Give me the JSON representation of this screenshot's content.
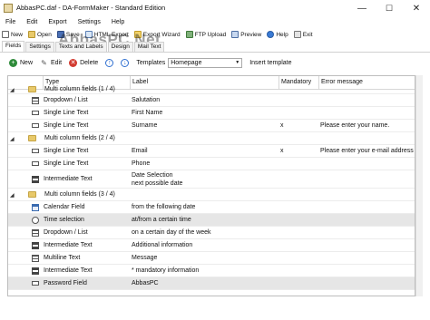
{
  "window": {
    "title": "AbbasPC.daf - DA-FormMaker - Standard Edition",
    "minimize": "—",
    "maximize": "☐",
    "close": "✕"
  },
  "menu": [
    "File",
    "Edit",
    "Export",
    "Settings",
    "Help"
  ],
  "toolbar": {
    "new": "New",
    "open": "Open",
    "save": "Save",
    "html_export": "HTML Export",
    "export_wizard": "Export Wizard",
    "ftp_upload": "FTP Upload",
    "preview": "Preview",
    "help": "Help",
    "exit": "Exit"
  },
  "watermark": "AbbasPC.Net",
  "tabs": [
    "Fields",
    "Settings",
    "Texts and Labels",
    "Design",
    "Mail Text"
  ],
  "actions": {
    "new": "New",
    "edit": "Edit",
    "delete": "Delete",
    "templates_label": "Templates",
    "templates_value": "Homepage",
    "insert_template": "Insert template"
  },
  "columns": {
    "type": "Type",
    "label": "Label",
    "mandatory": "Mandatory",
    "error": "Error message"
  },
  "rows": [
    {
      "kind": "group",
      "type": "Multi column fields (1 / 4)",
      "label": "",
      "mandatory": "",
      "error": ""
    },
    {
      "kind": "field",
      "icon": "dropdown-list",
      "type": "Dropdown / List",
      "label": "Salutation",
      "mandatory": "",
      "error": ""
    },
    {
      "kind": "field",
      "icon": "single-line",
      "type": "Single Line Text",
      "label": "First Name",
      "mandatory": "",
      "error": ""
    },
    {
      "kind": "field",
      "icon": "single-line",
      "type": "Single Line Text",
      "label": "Surname",
      "mandatory": "x",
      "error": "Please enter your name."
    },
    {
      "kind": "group",
      "type": "Multi column fields (2 / 4)",
      "label": "",
      "mandatory": "",
      "error": ""
    },
    {
      "kind": "field",
      "icon": "single-line",
      "type": "Single Line Text",
      "label": "Email",
      "mandatory": "x",
      "error": "Please enter your e-mail address sc"
    },
    {
      "kind": "field",
      "icon": "single-line",
      "type": "Single Line Text",
      "label": "Phone",
      "mandatory": "",
      "error": ""
    },
    {
      "kind": "field",
      "icon": "intermediate-text",
      "type": "Intermediate Text",
      "label": "Date Selection",
      "label2": "next possible date",
      "mandatory": "",
      "error": ""
    },
    {
      "kind": "group",
      "type": "Multi column fields (3 / 4)",
      "label": "",
      "mandatory": "",
      "error": ""
    },
    {
      "kind": "field",
      "icon": "calendar",
      "type": "Calendar Field",
      "label": "from the following date",
      "mandatory": "",
      "error": ""
    },
    {
      "kind": "field",
      "icon": "time",
      "type": "Time selection",
      "label": "at/from a certain time",
      "mandatory": "",
      "error": "",
      "selected": true
    },
    {
      "kind": "field",
      "icon": "dropdown-list",
      "type": "Dropdown / List",
      "label": "on a certain day of the week",
      "mandatory": "",
      "error": ""
    },
    {
      "kind": "field",
      "icon": "intermediate-text",
      "type": "Intermediate Text",
      "label": "Additional information",
      "mandatory": "",
      "error": ""
    },
    {
      "kind": "field",
      "icon": "multiline",
      "type": "Multiline Text",
      "label": "Message",
      "mandatory": "",
      "error": ""
    },
    {
      "kind": "field",
      "icon": "intermediate-text",
      "type": "Intermediate Text",
      "label": "* mandatory information",
      "mandatory": "",
      "error": ""
    },
    {
      "kind": "field",
      "icon": "password",
      "type": "Password Field",
      "label": "AbbasPC",
      "mandatory": "",
      "error": "",
      "selected": true
    }
  ]
}
